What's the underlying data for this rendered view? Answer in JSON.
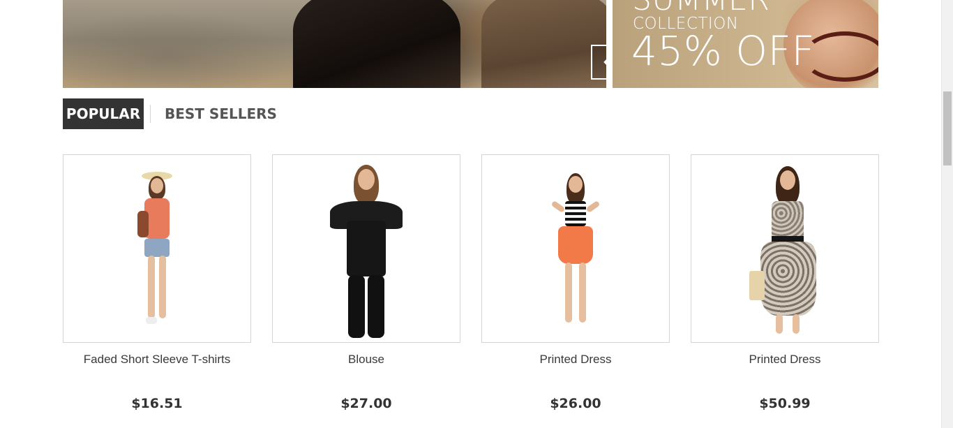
{
  "banners": {
    "slider": {
      "prev_icon": "chevron-left-icon",
      "next_icon": "chevron-right-icon"
    },
    "promo": {
      "headline": "SUMMER",
      "subline": "COLLECTION",
      "offer": "45% OFF"
    }
  },
  "tabs": [
    {
      "label": "POPULAR",
      "active": true
    },
    {
      "label": "BEST SELLERS",
      "active": false
    }
  ],
  "products": [
    {
      "name": "Faded Short Sleeve T-shirts",
      "price": "$16.51"
    },
    {
      "name": "Blouse",
      "price": "$27.00"
    },
    {
      "name": "Printed Dress",
      "price": "$26.00"
    },
    {
      "name": "Printed Dress",
      "price": "$50.99"
    }
  ],
  "colors": {
    "tab_active_bg": "#333333",
    "border": "#d6d4d4",
    "text": "#333333"
  }
}
